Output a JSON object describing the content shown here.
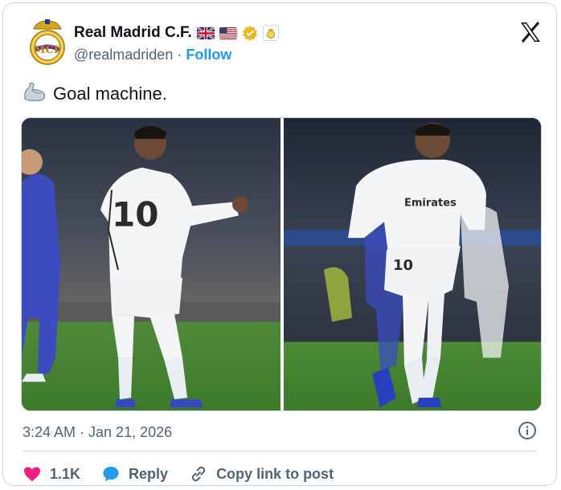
{
  "account": {
    "display_name": "Real Madrid C.F.",
    "handle": "@realmadriden",
    "separator": "·",
    "follow_label": "Follow"
  },
  "tweet": {
    "text": "Goal machine.",
    "timestamp": "3:24 AM · Jan 21, 2026"
  },
  "actions": {
    "likes_count": "1.1K",
    "reply_label": "Reply",
    "copy_link_label": "Copy link to post"
  },
  "icons": {
    "like": "heart-icon",
    "reply": "speech-bubble-icon",
    "copy": "link-icon",
    "info": "info-icon",
    "brand": "x-logo-icon"
  },
  "colors": {
    "like": "#f91880",
    "reply": "#1d9bf0",
    "follow": "#1d9bf0",
    "muted": "#536471",
    "verified": "#e8b923"
  }
}
